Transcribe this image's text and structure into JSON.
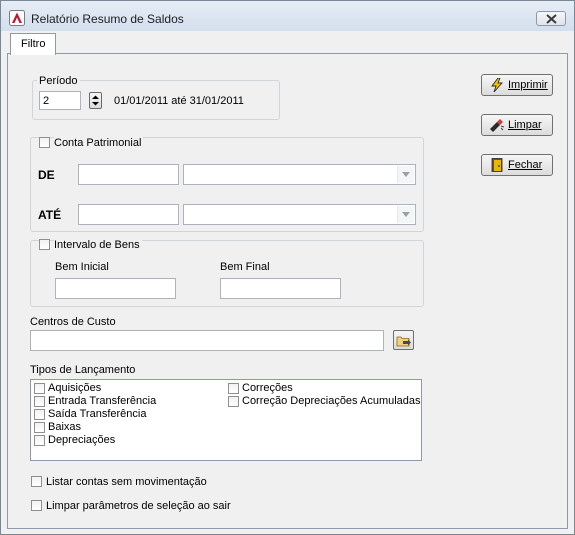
{
  "window": {
    "title": "Relatório Resumo de Saldos"
  },
  "tabs": [
    {
      "label": "Filtro"
    }
  ],
  "periodo": {
    "label": "Período",
    "value": "2",
    "range_text": "01/01/2011 até 31/01/2011"
  },
  "conta_patrimonial": {
    "label": "Conta Patrimonial",
    "checked": false,
    "de_label": "DE",
    "ate_label": "ATÉ",
    "de_value": "",
    "ate_value": ""
  },
  "intervalo_bens": {
    "label": "Intervalo de Bens",
    "checked": false,
    "bem_inicial_label": "Bem Inicial",
    "bem_final_label": "Bem Final",
    "bem_inicial_value": "",
    "bem_final_value": ""
  },
  "centros_custo": {
    "label": "Centros de Custo",
    "value": ""
  },
  "tipos_lancamento": {
    "label": "Tipos de Lançamento",
    "col1": [
      "Aquisições",
      "Entrada Transferência",
      "Saída Transferência",
      "Baixas",
      "Depreciações"
    ],
    "col2": [
      "Correções",
      "Correção Depreciações Acumuladas"
    ]
  },
  "options": {
    "listar_contas": "Listar contas sem movimentação",
    "limpar_parametros": "Limpar parâmetros de seleção ao sair"
  },
  "buttons": {
    "imprimir": "Imprimir",
    "limpar": "Limpar",
    "fechar": "Fechar"
  },
  "icons": {
    "app": "app-logo-icon",
    "close": "close-icon",
    "imprimir": "lightning-icon",
    "limpar": "eraser-icon",
    "fechar": "exit-door-icon",
    "lookup": "folder-lookup-icon"
  }
}
